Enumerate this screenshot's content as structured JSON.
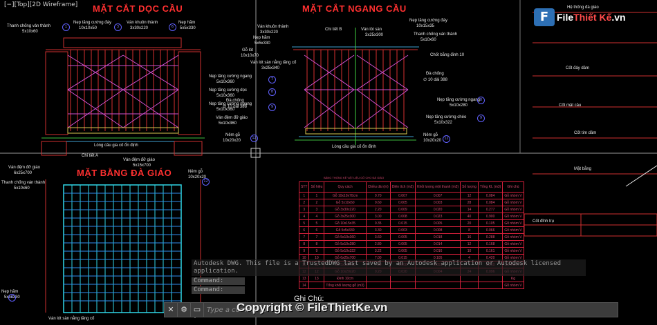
{
  "viewport_label": "[−][Top][2D Wireframe]",
  "logo": {
    "prefix": "F",
    "part1": "File",
    "part2": "Thiết Kế",
    "suffix": ".vn"
  },
  "titles": {
    "long_section": "MẶT CẮT DỌC CẦU",
    "cross_section": "MẶT CẮT NGANG CẦU",
    "scaffold_plan": "MẶT BẰNG ĐÀ GIÁO"
  },
  "long_labels": [
    "Thanh chống ván thành",
    "5x10x60",
    "Nẹp tăng cường đáy",
    "10x10x50",
    "Ván khuôn thành",
    "3x30x220",
    "Nẹp hãm",
    "5x5x330",
    "Nẹp tăng cường ngang",
    "5x10x360",
    "Nẹp tăng cường dọc",
    "5x10x360",
    "Nẹp tăng cường ngang",
    "5x10x360",
    "Đà chống",
    "∅ 10 dài 388",
    "Ván đệm đỡ giáo",
    "5x10x360",
    "Nêm gỗ",
    "10x20x20",
    "Lòng cầu gia cố ổn định",
    "Chi tiết A"
  ],
  "cross_labels": [
    "Ván khuôn thành",
    "3x30x220",
    "Ván lót sàn",
    "3x25x300",
    "Nẹp tăng cường đáy",
    "10x15x35",
    "Thanh chống ván thành",
    "5x10x60",
    "Nẹp hãm",
    "5x5x330",
    "Chốt bằng đinh 10",
    "Gỗ lót",
    "10x10x70",
    "Ván lót sàn nằng tăng cố",
    "3x25x340",
    "Đà chống",
    "∅ 10 dài 388",
    "Nẹp tăng cường ngang",
    "5x10x280",
    "Nẹp tăng cường chéo",
    "5x10x322",
    "Nêm gỗ",
    "10x20x20",
    "Lòng cầu gia cố ổn định",
    "Chi tiết B"
  ],
  "plan_labels": [
    "Ván đệm đỡ giáo",
    "6x25x700",
    "Thanh chống ván thành",
    "5x10x60",
    "Nẹp hãm",
    "5x5x330",
    "Ván đệm đỡ giáo",
    "5x15x700",
    "Nêm gỗ",
    "10x20x20",
    "Ván lót sàn nằng tăng cố",
    "Đà chống"
  ],
  "table": {
    "caption": "BẢNG THỐNG KÊ VẬT LIỆU GỖ CHO ĐÀ GIÁO",
    "headers": [
      "STT",
      "Số hiệu",
      "Quy cách",
      "Chiều dài (m)",
      "Diện tích (m2)",
      "Khối lượng một thanh (m3)",
      "Số lượng",
      "Tổng KL (m3)",
      "Ghi chú"
    ],
    "rows": [
      [
        "1",
        "1",
        "Gỗ 10x10x70cm",
        "0.70",
        "0.007",
        "0.007",
        "12",
        "0.084",
        "Gỗ nhóm V"
      ],
      [
        "2",
        "2",
        "Gỗ 5x10x60",
        "0.60",
        "0.005",
        "0.003",
        "28",
        "0.084",
        "Gỗ nhóm V"
      ],
      [
        "3",
        "3",
        "Gỗ 3x30x220",
        "2.20",
        "0.009",
        "0.020",
        "14",
        "0.277",
        "Gỗ nhóm V"
      ],
      [
        "4",
        "4",
        "Gỗ 3x25x300",
        "3.00",
        "0.008",
        "0.023",
        "40",
        "0.900",
        "Gỗ nhóm V"
      ],
      [
        "5",
        "5",
        "Gỗ 10x15x35",
        "0.35",
        "0.015",
        "0.005",
        "20",
        "0.105",
        "Gỗ nhóm V"
      ],
      [
        "6",
        "6",
        "Gỗ 5x5x330",
        "3.30",
        "0.003",
        "0.008",
        "8",
        "0.066",
        "Gỗ nhóm V"
      ],
      [
        "7",
        "7",
        "Gỗ 5x10x360",
        "3.60",
        "0.005",
        "0.018",
        "16",
        "0.288",
        "Gỗ nhóm V"
      ],
      [
        "8",
        "8",
        "Gỗ 5x10x280",
        "2.80",
        "0.005",
        "0.014",
        "12",
        "0.168",
        "Gỗ nhóm V"
      ],
      [
        "9",
        "9",
        "Gỗ 5x10x322",
        "3.22",
        "0.005",
        "0.016",
        "10",
        "0.161",
        "Gỗ nhóm V"
      ],
      [
        "10",
        "10",
        "Gỗ 6x25x700",
        "7.00",
        "0.015",
        "0.105",
        "4",
        "0.420",
        "Gỗ nhóm V"
      ],
      [
        "11",
        "11",
        "Gỗ 5x15x700",
        "7.00",
        "0.008",
        "0.053",
        "4",
        "0.210",
        "Gỗ nhóm V"
      ],
      [
        "12",
        "12",
        "Gỗ 10x20x20",
        "0.20",
        "0.020",
        "0.004",
        "24",
        "0.096",
        "Gỗ nhóm V"
      ],
      [
        "13",
        "13",
        "Đinh 10cm",
        "",
        "",
        "",
        "",
        "",
        "Kg"
      ],
      [
        "14",
        "",
        "Tổng khối lượng gỗ (m3)",
        "",
        "",
        "",
        "",
        "",
        "Gỗ nhóm V"
      ]
    ]
  },
  "right_annotations": [
    "Hệ thống đà giáo",
    "Cốt đáy dầm",
    "Cốt mặt cầu",
    "Cốt tim dầm",
    "Mặt bằng",
    "Cốt đỉnh trụ"
  ],
  "command": {
    "message": "Autodesk DWG.  This file is a TrustedDWG last saved by an Autodesk application or Autodesk licensed application.",
    "lines": [
      "Command:",
      "Command:"
    ],
    "placeholder": "Type a command"
  },
  "ghi_chu": "Ghi Chú:",
  "watermark": "Copyright © FileThietKe.vn"
}
